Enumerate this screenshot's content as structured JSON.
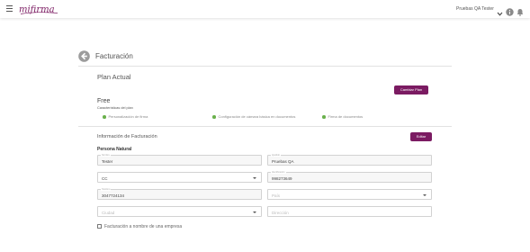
{
  "header": {
    "logo_text": "mifirma",
    "user_name": "Pruebas QA Tester"
  },
  "page": {
    "title": "Facturación"
  },
  "plan": {
    "section_title": "Plan Actual",
    "change_button": "Cambiar Plan",
    "name": "Free",
    "subtitle": "Características del plan",
    "features": [
      "Personalización de firma",
      "Configuración de cámara básica en documentos",
      "Firma de documentos"
    ]
  },
  "billing": {
    "title": "Información de Facturación",
    "edit_button": "Editar",
    "person_type": "Persona Natural",
    "fields": {
      "first_name": {
        "label": "Nombre",
        "value": "Tester"
      },
      "last_name": {
        "label": "Apellido",
        "value": "Pruebas QA"
      },
      "doc_type": {
        "label": "",
        "value": "CC"
      },
      "doc_number": {
        "label": "Identificación",
        "value": "998273649"
      },
      "phone": {
        "label": "Teléfono",
        "value": "3047724134"
      },
      "country": {
        "placeholder": "País"
      },
      "city": {
        "placeholder": "Ciudad"
      },
      "address": {
        "placeholder": "Dirección"
      }
    },
    "company_checkbox_label": "Facturación a nombre de una empresa"
  },
  "colors": {
    "accent": "#7b1b62",
    "feature_dot": "#6ab04c"
  }
}
